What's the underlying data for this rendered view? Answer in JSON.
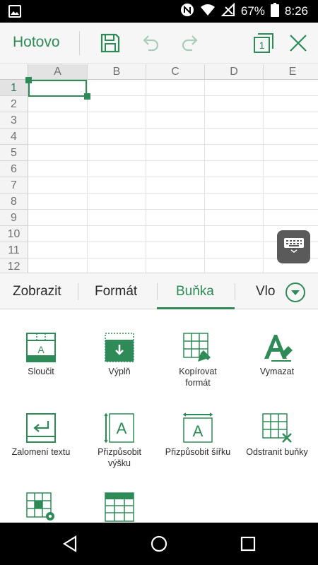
{
  "status_bar": {
    "battery": "67%",
    "time": "8:26",
    "icons": [
      "image-icon",
      "nfc-icon",
      "wifi-icon",
      "signal-off-icon",
      "battery-icon"
    ]
  },
  "toolbar": {
    "done_label": "Hotovo",
    "icons": [
      "save-icon",
      "undo-icon",
      "redo-icon",
      "sheets-icon",
      "close-icon"
    ],
    "sheet_count": "1"
  },
  "sheet": {
    "columns": [
      "A",
      "B",
      "C",
      "D",
      "E"
    ],
    "rows": [
      "1",
      "2",
      "3",
      "4",
      "5",
      "6",
      "7",
      "8",
      "9",
      "10",
      "11",
      "12"
    ],
    "selected_cell": "A1"
  },
  "tabs": {
    "items": [
      "Zobrazit",
      "Formát",
      "Buňka",
      "Vlo"
    ],
    "active": "Buňka"
  },
  "actions": {
    "merge": "Sloučit",
    "fill": "Výplň",
    "copy_format": "Kopírovat formát",
    "clear": "Vymazat",
    "wrap_text": "Zalomení textu",
    "fit_height": "Přizpůsobit výšku",
    "fit_width": "Přizpůsobit šířku",
    "delete_cells": "Odstranit buňky"
  },
  "colors": {
    "accent": "#2e8b57",
    "status_bar": "#000000",
    "nav_bar": "#000000"
  }
}
